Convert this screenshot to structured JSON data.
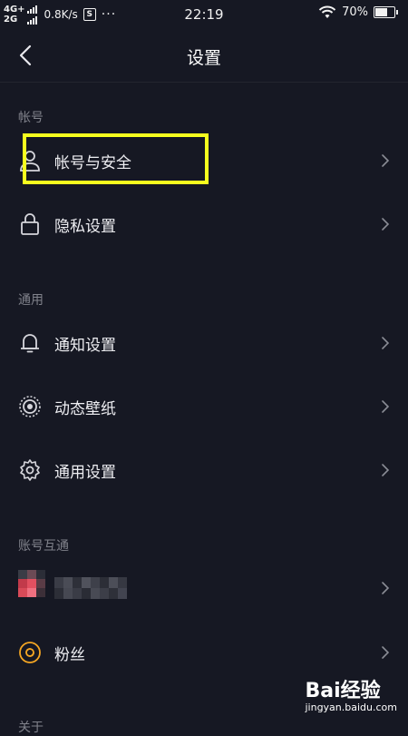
{
  "status_bar": {
    "network_top": "4G+",
    "network_bottom": "2G",
    "speed": "0.8K/s",
    "app_badge": "S",
    "more": "···",
    "time": "22:19",
    "battery_text": "70%",
    "battery_level": 0.7
  },
  "nav": {
    "title": "设置"
  },
  "sections": {
    "account": {
      "header": "帐号",
      "items": [
        {
          "label": "帐号与安全",
          "icon": "user-icon"
        },
        {
          "label": "隐私设置",
          "icon": "lock-icon"
        }
      ]
    },
    "general": {
      "header": "通用",
      "items": [
        {
          "label": "通知设置",
          "icon": "bell-icon"
        },
        {
          "label": "动态壁纸",
          "icon": "wallpaper-icon"
        },
        {
          "label": "通用设置",
          "icon": "gear-icon"
        }
      ]
    },
    "linked": {
      "header": "账号互通",
      "items": [
        {
          "label": "",
          "icon": "avatar-icon"
        },
        {
          "label": "粉丝",
          "icon": "fans-icon"
        }
      ]
    },
    "next": {
      "header": "关于"
    }
  },
  "colors": {
    "background": "#161823",
    "highlight": "#f5ff1e",
    "fans_accent": "#f5a623"
  },
  "watermark": {
    "logo": "Bai经验",
    "url": "jingyan.baidu.com"
  }
}
